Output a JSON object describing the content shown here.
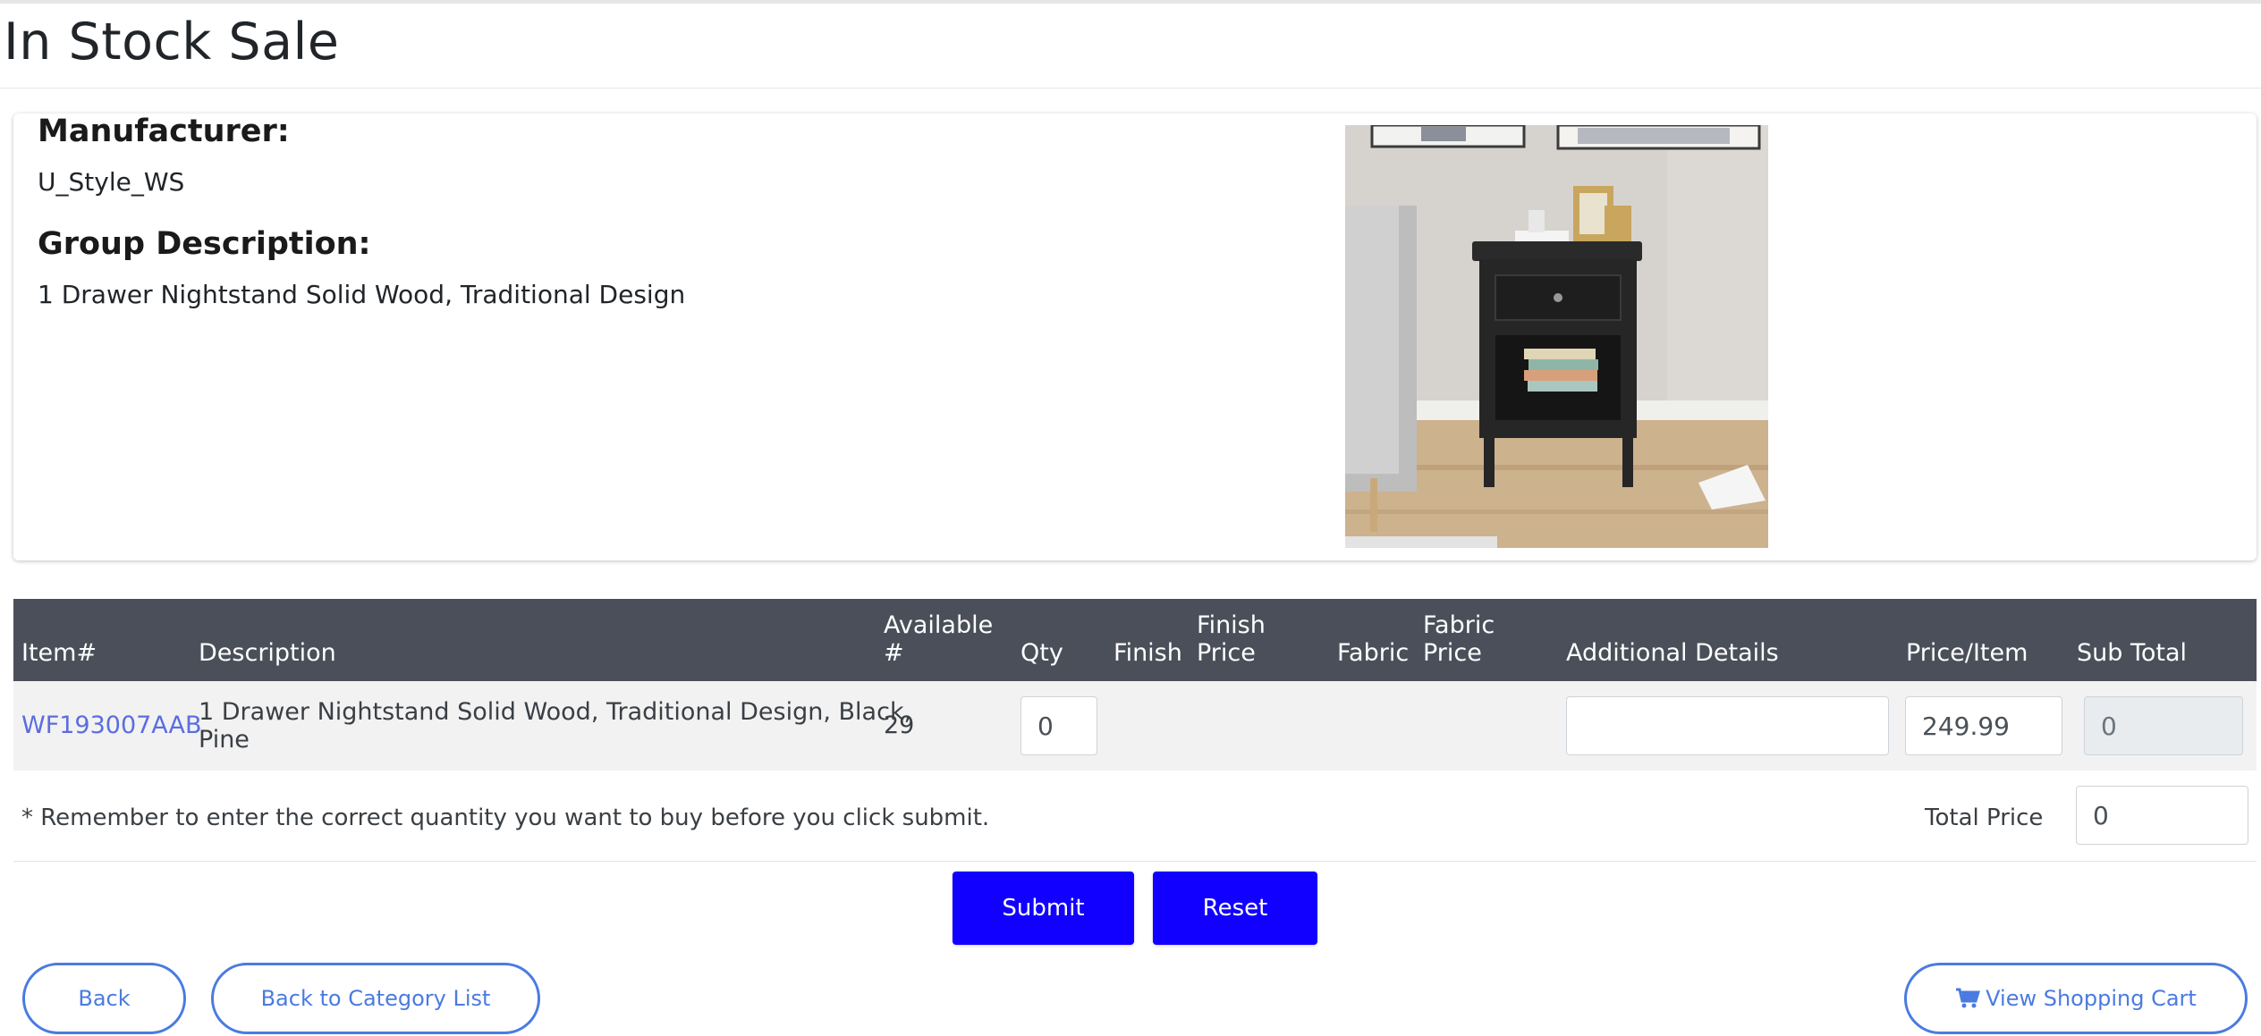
{
  "page": {
    "title": "In Stock Sale"
  },
  "details": {
    "manufacturer_label": "Manufacturer:",
    "manufacturer": "U_Style_WS",
    "group_label": "Group Description:",
    "group_description": "1 Drawer Nightstand Solid Wood, Traditional Design"
  },
  "table": {
    "headers": {
      "item": "Item#",
      "description": "Description",
      "available_1": "Available",
      "available_2": "#",
      "qty": "Qty",
      "finish": "Finish",
      "finish_price_1": "Finish",
      "finish_price_2": "Price",
      "fabric": "Fabric",
      "fabric_price_1": "Fabric",
      "fabric_price_2": "Price",
      "additional": "Additional Details",
      "price_item": "Price/Item",
      "sub_total": "Sub Total"
    },
    "row": {
      "item": "WF193007AAB",
      "description_1": "1 Drawer Nightstand Solid Wood, Traditional Design, Black,",
      "description_2": "Pine",
      "available": "29",
      "qty": "0",
      "additional": "",
      "price": "249.99",
      "sub_total": "0"
    }
  },
  "footer": {
    "remark": "* Remember to enter the correct quantity you want to buy before you click submit.",
    "total_label": "Total Price",
    "total_value": "0"
  },
  "buttons": {
    "submit": "Submit",
    "reset": "Reset",
    "back": "Back",
    "back_category": "Back to Category List",
    "view_cart": "View Shopping Cart"
  },
  "colors": {
    "header_bg": "#4a4f5a",
    "primary_button": "#1100ff",
    "link": "#5b6de0",
    "outline_button": "#4a7be0"
  }
}
